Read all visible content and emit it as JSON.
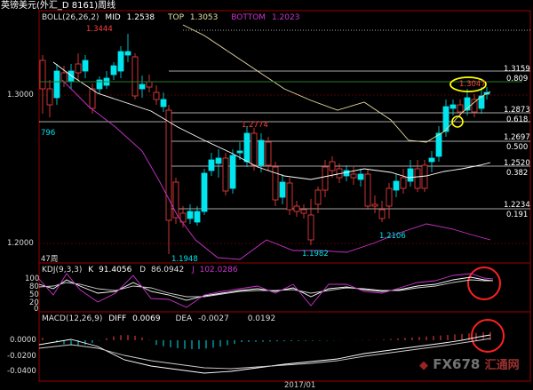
{
  "window": {
    "title": "英镑美元(外汇_D 8161)周线"
  },
  "boll": {
    "label": "BOLL(26,26,2)",
    "mid_label": "MID",
    "mid_value": "1.2538",
    "top_label": "TOP",
    "top_value": "1.3053",
    "bottom_label": "BOTTOM",
    "bottom_value": "1.2023"
  },
  "price_axis": {
    "upper": "1.3000",
    "lower": "1.2000"
  },
  "annotations": {
    "high_1": "1.3444",
    "high_2": "1.3047",
    "mid_high": "1.2774",
    "low_1": "1.1948",
    "low_2": "1.1982",
    "low_3": "1.2106",
    "left_number": "796",
    "period_count": "47周"
  },
  "fib_levels": [
    {
      "price": "1.3159",
      "ratio": "0.809"
    },
    {
      "price": "1.2873",
      "ratio": "0.618"
    },
    {
      "price": "1.2697",
      "ratio": "0.500"
    },
    {
      "price": "1.2520",
      "ratio": "0.382"
    },
    {
      "price": "1.2234",
      "ratio": "0.191"
    }
  ],
  "kdj": {
    "label": "KDJ(9,3,3)",
    "k_label": "K",
    "k_value": "91.4056",
    "d_label": "D",
    "d_value": "86.0942",
    "j_label": "J",
    "j_value": "102.0286",
    "ticks": [
      "100",
      "80",
      "50",
      "20",
      "0"
    ]
  },
  "macd": {
    "label": "MACD(12,26,9)",
    "diff_label": "DIFF",
    "diff_value": "0.0069",
    "dea_label": "DEA",
    "dea_value": "-0.0027",
    "macd_value": "0.0192",
    "ticks": [
      "0.0000",
      "-0.0200",
      "-0.0400"
    ]
  },
  "date_axis": {
    "label": "2017/01"
  },
  "watermark": {
    "text": "FX678",
    "sub": "汇通网"
  },
  "colors": {
    "up": "#00e5ee",
    "down": "#ff4040",
    "boll_mid": "#ffffff",
    "boll_top": "#e8e0a0",
    "boll_bottom": "#cc33cc",
    "highlight": "#ffff00",
    "circle": "#ff2020"
  }
}
